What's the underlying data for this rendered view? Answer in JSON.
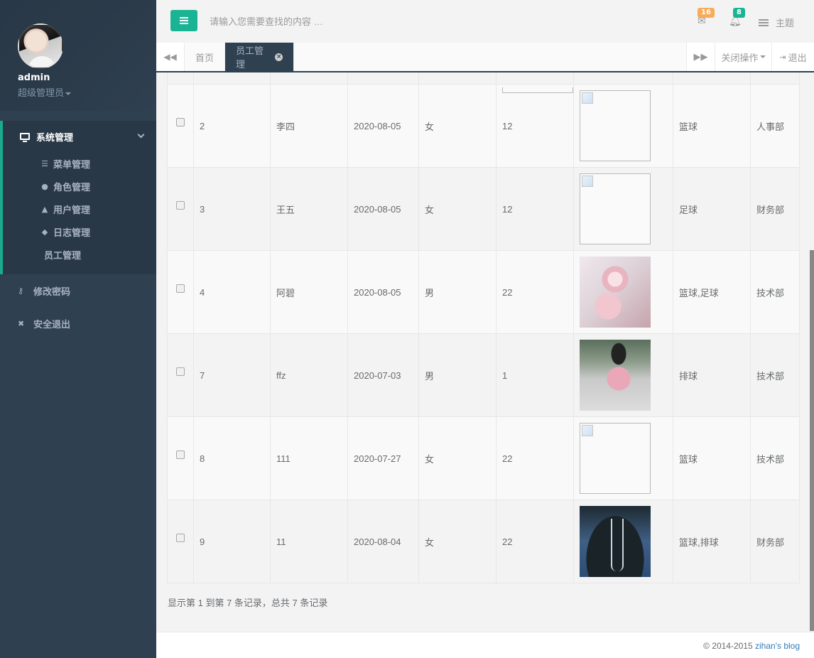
{
  "profile": {
    "name": "admin",
    "role": "超级管理员"
  },
  "sidebar": {
    "group_title": "系统管理",
    "sub_items": [
      {
        "label": "菜单管理",
        "icon": "sliders-icon"
      },
      {
        "label": "角色管理",
        "icon": "users-icon"
      },
      {
        "label": "用户管理",
        "icon": "user-icon"
      },
      {
        "label": "日志管理",
        "icon": "tags-icon"
      },
      {
        "label": "员工管理",
        "icon": ""
      }
    ],
    "items": [
      {
        "label": "修改密码",
        "icon": "key-icon"
      },
      {
        "label": "安全退出",
        "icon": "user-times-icon"
      }
    ]
  },
  "topbar": {
    "search_placeholder": "请输入您需要查找的内容 …",
    "mail_count": "16",
    "bell_count": "8",
    "theme_label": "主题"
  },
  "tabs": {
    "home": "首页",
    "active": "员工管理",
    "close_ops": "关闭操作",
    "logout": "退出"
  },
  "table": {
    "rows": [
      {
        "id": "2",
        "name": "李四",
        "date": "2020-08-05",
        "gender": "女",
        "age": "12",
        "photo": "broken",
        "hobby": "篮球",
        "dept": "人事部"
      },
      {
        "id": "3",
        "name": "王五",
        "date": "2020-08-05",
        "gender": "女",
        "age": "12",
        "photo": "broken",
        "hobby": "足球",
        "dept": "财务部"
      },
      {
        "id": "4",
        "name": "阿碧",
        "date": "2020-08-05",
        "gender": "男",
        "age": "22",
        "photo": "pink",
        "hobby": "篮球,足球",
        "dept": "技术部"
      },
      {
        "id": "7",
        "name": "ffz",
        "date": "2020-07-03",
        "gender": "男",
        "age": "1",
        "photo": "street",
        "hobby": "排球",
        "dept": "技术部"
      },
      {
        "id": "8",
        "name": "111",
        "date": "2020-07-27",
        "gender": "女",
        "age": "22",
        "photo": "broken",
        "hobby": "篮球",
        "dept": "技术部"
      },
      {
        "id": "9",
        "name": "11",
        "date": "2020-08-04",
        "gender": "女",
        "age": "22",
        "photo": "dark",
        "hobby": "篮球,排球",
        "dept": "财务部"
      }
    ]
  },
  "pagination": {
    "summary": "显示第 1 到第 7 条记录，总共 7 条记录"
  },
  "footer": {
    "copyright": "© 2014-2015 ",
    "link": "zihan's blog"
  },
  "colors": {
    "accent": "#1ab394",
    "sidebar": "#2f4050",
    "mail_badge": "#f8ac59",
    "bell_badge": "#1ab394"
  }
}
